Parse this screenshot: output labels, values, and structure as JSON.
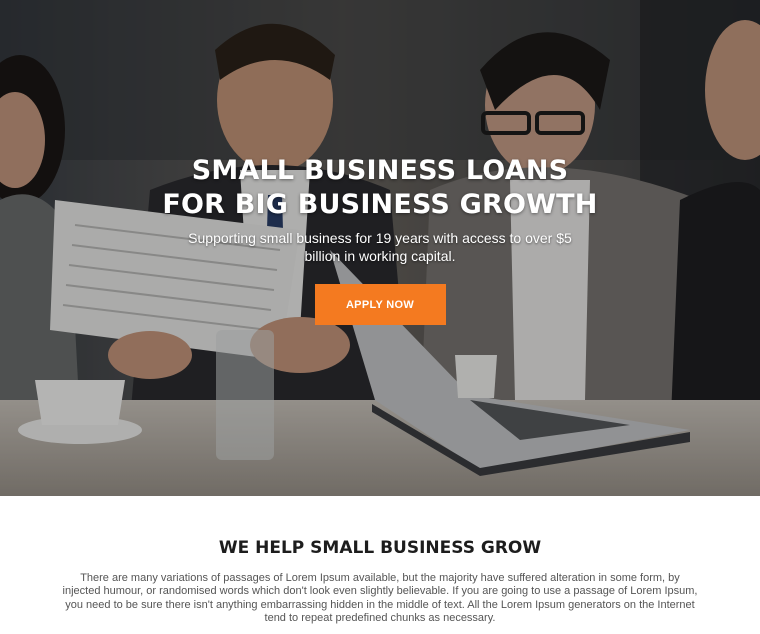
{
  "hero": {
    "title_line1": "SMALL BUSINESS LOANS",
    "title_line2": "FOR BIG BUSINESS GROWTH",
    "subtitle": "Supporting small business for 19 years with access to over $5 billion in working capital.",
    "cta_label": "APPLY NOW"
  },
  "section": {
    "title": "WE HELP SMALL BUSINESS GROW",
    "body": "There are many variations of passages of Lorem Ipsum available, but the majority have suffered alteration in some form, by injected humour, or randomised words which don't look even slightly believable. If you are going to use a passage of Lorem Ipsum, you need to be sure there isn't anything embarrassing hidden in the middle of text. All the Lorem Ipsum generators on the Internet tend to repeat predefined chunks as necessary."
  },
  "colors": {
    "accent": "#f47a20",
    "heading": "#1d1d1d",
    "body_text": "#555555"
  }
}
